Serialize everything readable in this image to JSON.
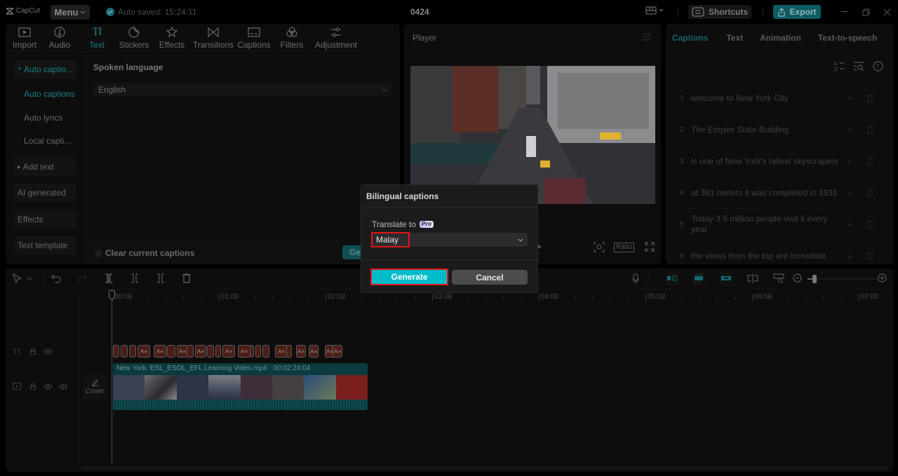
{
  "app": {
    "logo_text": "CapCut",
    "menu_label": "Menu",
    "autosave_text": "Auto saved: 15:24:11",
    "project_title": "0424",
    "shortcuts_label": "Shortcuts",
    "export_label": "Export"
  },
  "tool_tabs": [
    {
      "label": "Import",
      "icon": "import-icon"
    },
    {
      "label": "Audio",
      "icon": "audio-icon"
    },
    {
      "label": "Text",
      "icon": "text-icon",
      "active": true
    },
    {
      "label": "Stickers",
      "icon": "stickers-icon"
    },
    {
      "label": "Effects",
      "icon": "effects-icon"
    },
    {
      "label": "Transitions",
      "icon": "transitions-icon"
    },
    {
      "label": "Captions",
      "icon": "captions-icon"
    },
    {
      "label": "Filters",
      "icon": "filters-icon"
    },
    {
      "label": "Adjustment",
      "icon": "adjustment-icon"
    }
  ],
  "sub_nav": {
    "items": [
      {
        "label": "Auto captio...",
        "expanded": true
      },
      {
        "label": "Auto captions",
        "active": true
      },
      {
        "label": "Auto lyrics"
      },
      {
        "label": "Local capti..."
      },
      {
        "label": "Add text"
      },
      {
        "label": "AI generated"
      },
      {
        "label": "Effects"
      },
      {
        "label": "Text template"
      }
    ]
  },
  "captions_panel": {
    "spoken_language_label": "Spoken language",
    "spoken_language_value": "English",
    "clear_current_label": "Clear current captions",
    "generate_label": "Generate"
  },
  "player": {
    "title": "Player",
    "ratio_label": "Ratio"
  },
  "right_panel": {
    "tabs": [
      {
        "label": "Captions",
        "active": true
      },
      {
        "label": "Text"
      },
      {
        "label": "Animation"
      },
      {
        "label": "Text-to-speech"
      }
    ],
    "captions": [
      {
        "num": "1",
        "text": "welcome to New York City"
      },
      {
        "num": "2",
        "text": "The Empire State Building"
      },
      {
        "num": "3",
        "text": "is one of New York's tallest skyscrapers"
      },
      {
        "num": "4",
        "text": "at 381 meters it was completed in 1931"
      },
      {
        "num": "5",
        "text": "Today 3.5 million people visit it every year"
      },
      {
        "num": "6",
        "text": "the views from the top are incredible"
      }
    ]
  },
  "timeline": {
    "ruler_labels": [
      "00:00",
      "01:00",
      "02:00",
      "03:00",
      "04:00",
      "05:00",
      "06:00",
      "07:00"
    ],
    "video_clip_name": "New York. ESL_ESOL_EFL Learning Video.mp4",
    "video_clip_duration": "00:02:24:04",
    "cover_label": "Cover",
    "zoom_level_fraction": 0.1
  },
  "dialog": {
    "title": "Bilingual captions",
    "translate_label": "Translate to",
    "pro_badge": "Pro",
    "target_language": "Malay",
    "generate_label": "Generate",
    "cancel_label": "Cancel"
  },
  "colors": {
    "accent": "#00bcca",
    "highlight_border": "#e01515",
    "active_tab": "#1b7f86",
    "text_clip": "#4a1d16",
    "video_clip": "#0b3b3f"
  }
}
